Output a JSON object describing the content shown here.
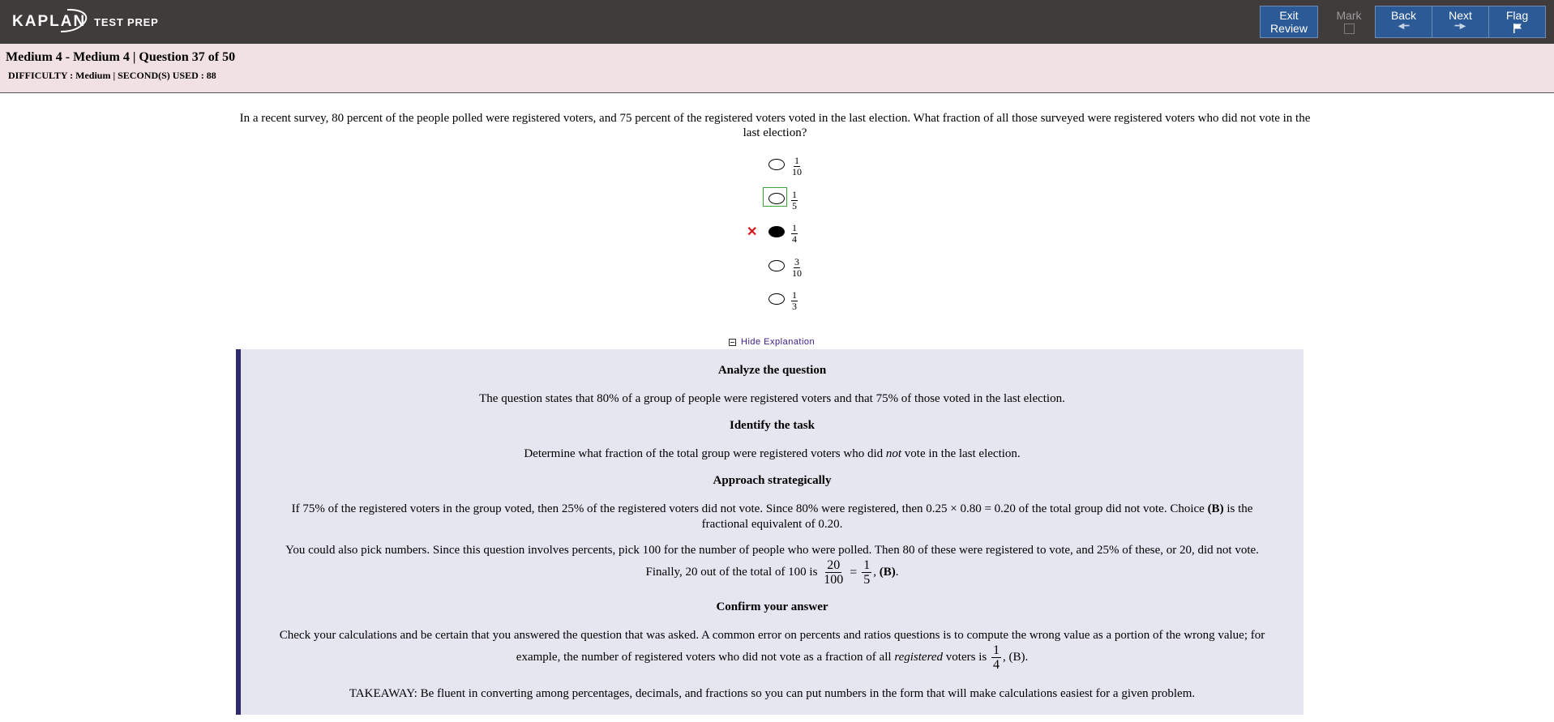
{
  "header": {
    "logo_text": "KAPLAN",
    "logo_sub": "TEST PREP",
    "buttons": {
      "exit_line1": "Exit",
      "exit_line2": "Review",
      "mark": "Mark",
      "back": "Back",
      "next": "Next",
      "flag": "Flag"
    }
  },
  "info": {
    "title": "Medium 4 - Medium 4 | Question  37 of 50",
    "difficulty_line": "DIFFICULTY : Medium | SECOND(S) USED : 88"
  },
  "question": {
    "text": "In a recent survey, 80 percent of the people polled were registered voters, and 75 percent of the registered voters voted in the last election. What fraction of all those surveyed were registered voters who did not vote in the last election?",
    "choices": [
      {
        "num": "1",
        "den": "10"
      },
      {
        "num": "1",
        "den": "5"
      },
      {
        "num": "1",
        "den": "4"
      },
      {
        "num": "3",
        "den": "10"
      },
      {
        "num": "1",
        "den": "3"
      }
    ],
    "selected_index": 2,
    "correct_index": 1,
    "wrong_mark": "✕"
  },
  "explanation": {
    "toggle_label": "Hide Explanation",
    "h1": "Analyze the question",
    "p1": "The question states that 80% of a group of people were registered voters and that 75% of those voted in the last election.",
    "h2": "Identify the task",
    "p2_a": "Determine what fraction of the total group were registered voters who did ",
    "p2_em": "not",
    "p2_b": " vote in the last election.",
    "h3": "Approach strategically",
    "p3_line1_a": "If 75% of the registered voters in the group voted, then 25% of the registered voters did not vote. Since 80% were registered, then 0.25 × 0.80 = 0.20 of the total group did not vote. Choice ",
    "p3_line1_b": "(B)",
    "p3_line1_c": " is the",
    "p3_line2": "fractional equivalent of 0.20.",
    "p4_line1": "You could also pick numbers. Since this question involves percents, pick 100 for the number of people who were polled. Then 80 of these were registered to vote, and 25% of these, or 20, did not vote.",
    "p4_line2_a": "Finally, 20 out of the total of 100 is",
    "p4_frac1_n": "20",
    "p4_frac1_d": "100",
    "p4_eq": "=",
    "p4_frac2_n": "1",
    "p4_frac2_d": "5",
    "p4_line2_b": ", ",
    "p4_line2_c": "(B)",
    "p4_line2_d": ".",
    "h4": "Confirm your answer",
    "p5_line1": "Check your calculations and be certain that you answered the question that was asked. A common error on percents and ratios questions is to compute the wrong value as a portion of the wrong value; for",
    "p5_line2_a": "example, the number of registered voters who did not vote as a fraction of all ",
    "p5_line2_em": "registered",
    "p5_line2_b": " voters is",
    "p5_frac_n": "1",
    "p5_frac_d": "4",
    "p5_line2_c": ", (B).",
    "p6": "TAKEAWAY: Be fluent in converting among percentages, decimals, and fractions so you can put numbers in the form that will make calculations easiest for a given problem."
  }
}
